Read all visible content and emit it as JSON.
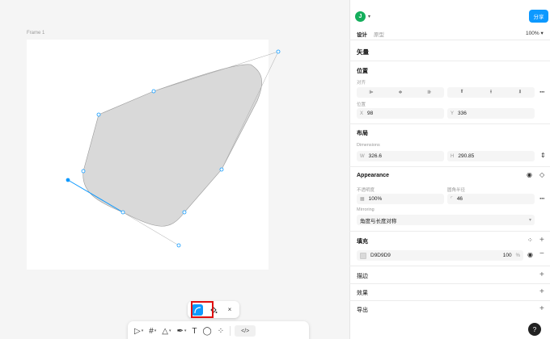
{
  "canvas": {
    "frame_label": "Frame 1"
  },
  "context_toolbar": {
    "bend_tool": "bend-tool",
    "paint_bucket": "paint-bucket",
    "close": "×"
  },
  "toolbar": {
    "move": "▷",
    "frame": "#",
    "shape": "△",
    "pen": "✒",
    "text": "T",
    "comment": "◯",
    "actions": "⁘",
    "dev_mode": "</>"
  },
  "header": {
    "avatar_letter": "J",
    "share_label": "分享",
    "tabs": [
      {
        "label": "设计"
      },
      {
        "label": "原型"
      }
    ],
    "zoom": "100%"
  },
  "panel": {
    "layer_type": "矢量",
    "position": {
      "title": "位置",
      "align_label": "对齐",
      "position_label": "位置",
      "x_label": "X",
      "x_value": "98",
      "y_label": "Y",
      "y_value": "336"
    },
    "layout": {
      "title": "布局",
      "dimensions_label": "Dimensions",
      "w_label": "W",
      "w_value": "326.6",
      "h_label": "H",
      "h_value": "290.85"
    },
    "appearance": {
      "title": "Appearance",
      "opacity_label": "不透明度",
      "opacity_value": "100%",
      "radius_label": "圆角半径",
      "radius_value": "46",
      "mirroring_label": "Mirroring",
      "mirroring_value": "角度与长度对称"
    },
    "fill": {
      "title": "填充",
      "color_hex": "D9D9D9",
      "opacity": "100",
      "unit": "%",
      "swatch_color": "#d9d9d9"
    },
    "stroke_title": "描边",
    "effects_title": "效果",
    "export_title": "导出"
  },
  "help_label": "?",
  "colors": {
    "accent": "#0d99ff",
    "avatar": "#14ae5c",
    "highlight": "#e01010",
    "shape_fill": "#d9d9d9"
  }
}
